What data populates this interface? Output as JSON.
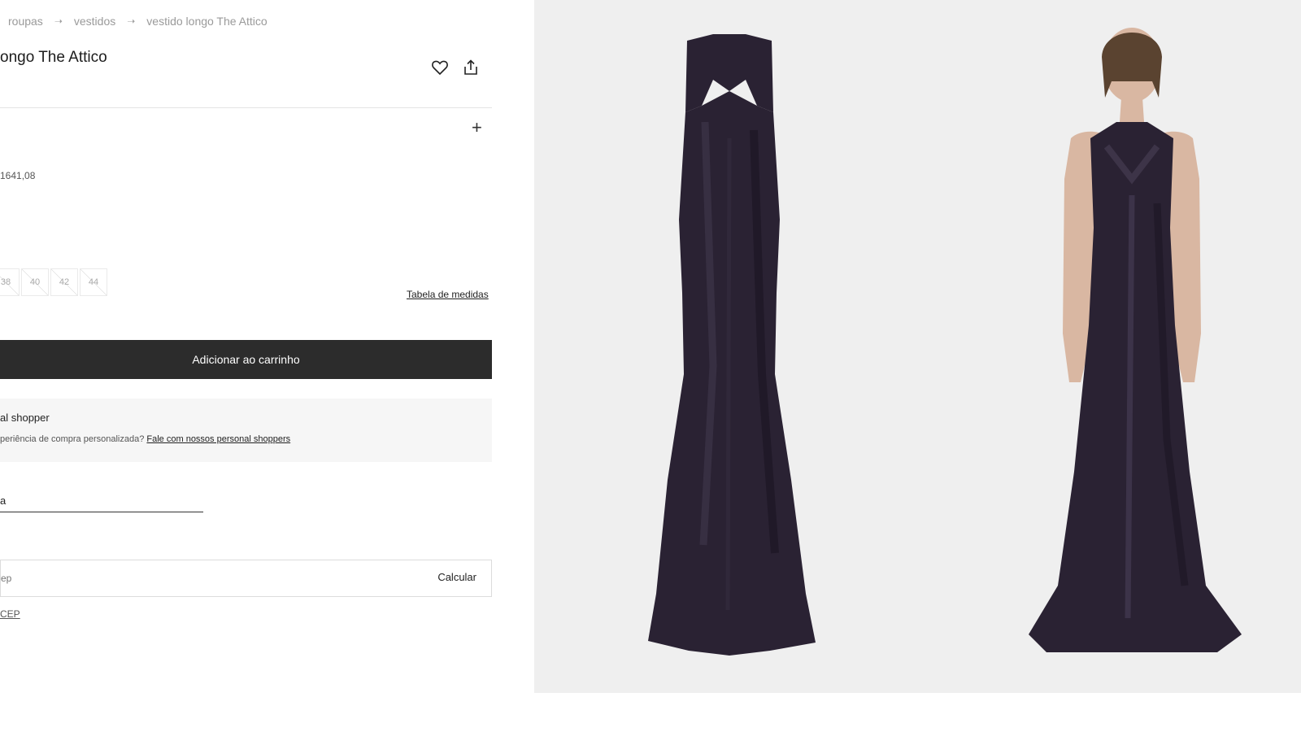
{
  "breadcrumb": [
    "roupas",
    "vestidos",
    "vestido longo The Attico"
  ],
  "product": {
    "title": "ongo The Attico",
    "price_fragment": "1641,08"
  },
  "icons": {
    "wishlist": "heart-icon",
    "share": "share-icon",
    "expand": "plus-icon"
  },
  "expand_symbol": "+",
  "sizes": [
    "38",
    "40",
    "42",
    "44"
  ],
  "size_table_label": "Tabela de medidas",
  "cart_button": "Adicionar ao carrinho",
  "shopper": {
    "title": "al shopper",
    "text": "periência de compra personalizada?",
    "link": "Fale com nossos personal shoppers"
  },
  "delivery": {
    "tab_label": "a"
  },
  "cep": {
    "placeholder": "ep",
    "button": "Calcular",
    "link": "CEP"
  },
  "colors": {
    "button_bg": "#2c2c2c",
    "gallery_bg": "#efefef",
    "dress": "#2a2233"
  }
}
